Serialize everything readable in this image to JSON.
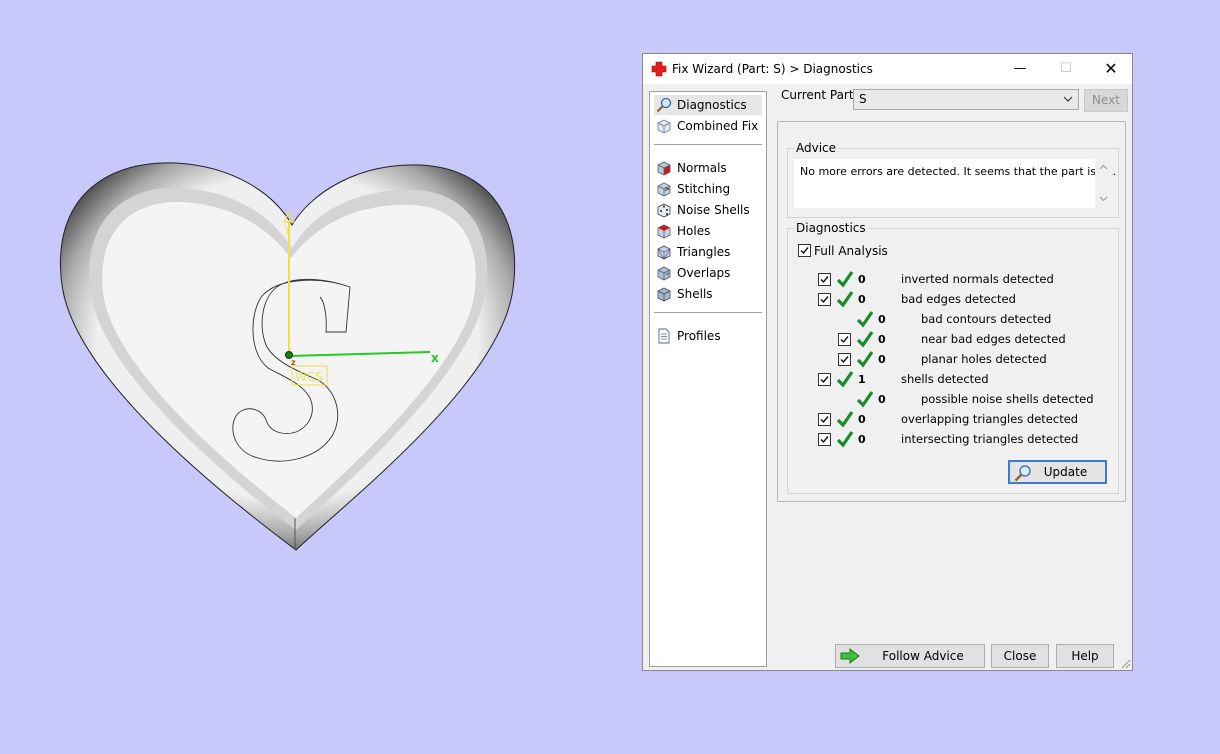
{
  "viewport": {
    "wcs_label": "WCS",
    "axis_labels": {
      "x": "x",
      "y": "y",
      "z": "z"
    },
    "colors": {
      "background": "#c8c8fa",
      "axis_x": "#22cc22",
      "axis_y": "#f0e040"
    }
  },
  "dialog": {
    "title": "Fix Wizard (Part: S) > Diagnostics",
    "title_icon": "red-cross-icon",
    "window_controls": {
      "minimize": "—",
      "maximize": "☐",
      "close": "✕"
    },
    "current_part_label": "Current Part:",
    "current_part_value": "S",
    "next_label": "Next",
    "nav": {
      "items": [
        {
          "label": "Diagnostics",
          "icon": "magnifier-icon"
        },
        {
          "label": "Combined Fix",
          "icon": "cube-icon"
        },
        {
          "label": "Normals",
          "icon": "cube-red-face-icon"
        },
        {
          "label": "Stitching",
          "icon": "stitch-cube-icon"
        },
        {
          "label": "Noise Shells",
          "icon": "dice-icon"
        },
        {
          "label": "Holes",
          "icon": "cube-hole-icon"
        },
        {
          "label": "Triangles",
          "icon": "triangle-cube-icon"
        },
        {
          "label": "Overlaps",
          "icon": "overlap-cube-icon"
        },
        {
          "label": "Shells",
          "icon": "shell-cube-icon"
        },
        {
          "label": "Profiles",
          "icon": "document-icon"
        }
      ]
    },
    "advice": {
      "title": "Advice",
      "text": "No more errors are detected. It seems that the part is ok."
    },
    "diagnostics": {
      "title": "Diagnostics",
      "full_analysis_label": "Full Analysis",
      "full_analysis_checked": true,
      "rows": [
        {
          "count": "0",
          "label": "inverted normals detected",
          "checked": true
        },
        {
          "count": "0",
          "label": "bad edges detected",
          "checked": true
        },
        {
          "count": "0",
          "label": "bad contours detected"
        },
        {
          "count": "0",
          "label": "near bad edges detected",
          "checked": true
        },
        {
          "count": "0",
          "label": "planar holes detected",
          "checked": true
        },
        {
          "count": "1",
          "label": "shells detected",
          "checked": true
        },
        {
          "count": "0",
          "label": "possible noise shells detected"
        },
        {
          "count": "0",
          "label": "overlapping triangles detected",
          "checked": true
        },
        {
          "count": "0",
          "label": "intersecting triangles detected",
          "checked": true
        }
      ],
      "update_label": "Update"
    },
    "buttons": {
      "follow_advice": "Follow Advice",
      "close": "Close",
      "help": "Help"
    }
  }
}
